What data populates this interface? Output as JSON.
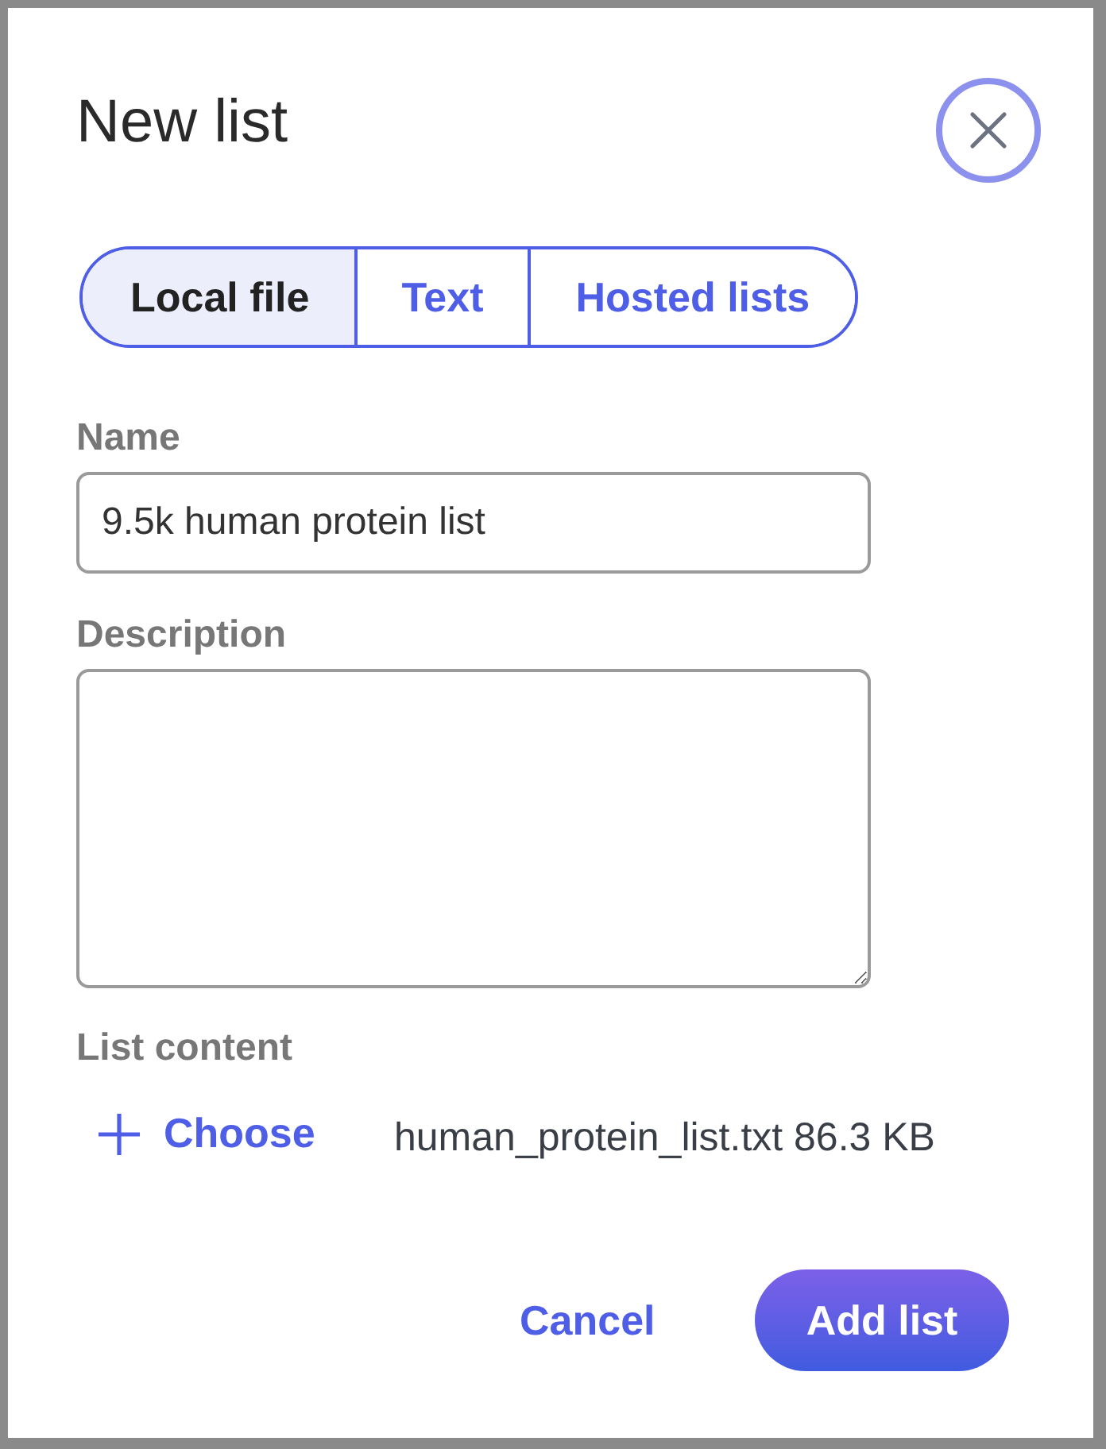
{
  "dialog": {
    "title": "New list"
  },
  "tabs": [
    {
      "label": "Local file",
      "selected": true
    },
    {
      "label": "Text",
      "selected": false
    },
    {
      "label": "Hosted lists",
      "selected": false
    }
  ],
  "name": {
    "label": "Name",
    "value": "9.5k human protein list"
  },
  "description": {
    "label": "Description"
  },
  "list_content": {
    "label": "List content",
    "choose": "Choose",
    "file": "human_protein_list.txt 86.3 KB"
  },
  "buttons": {
    "cancel": "Cancel",
    "submit": "Add list"
  }
}
